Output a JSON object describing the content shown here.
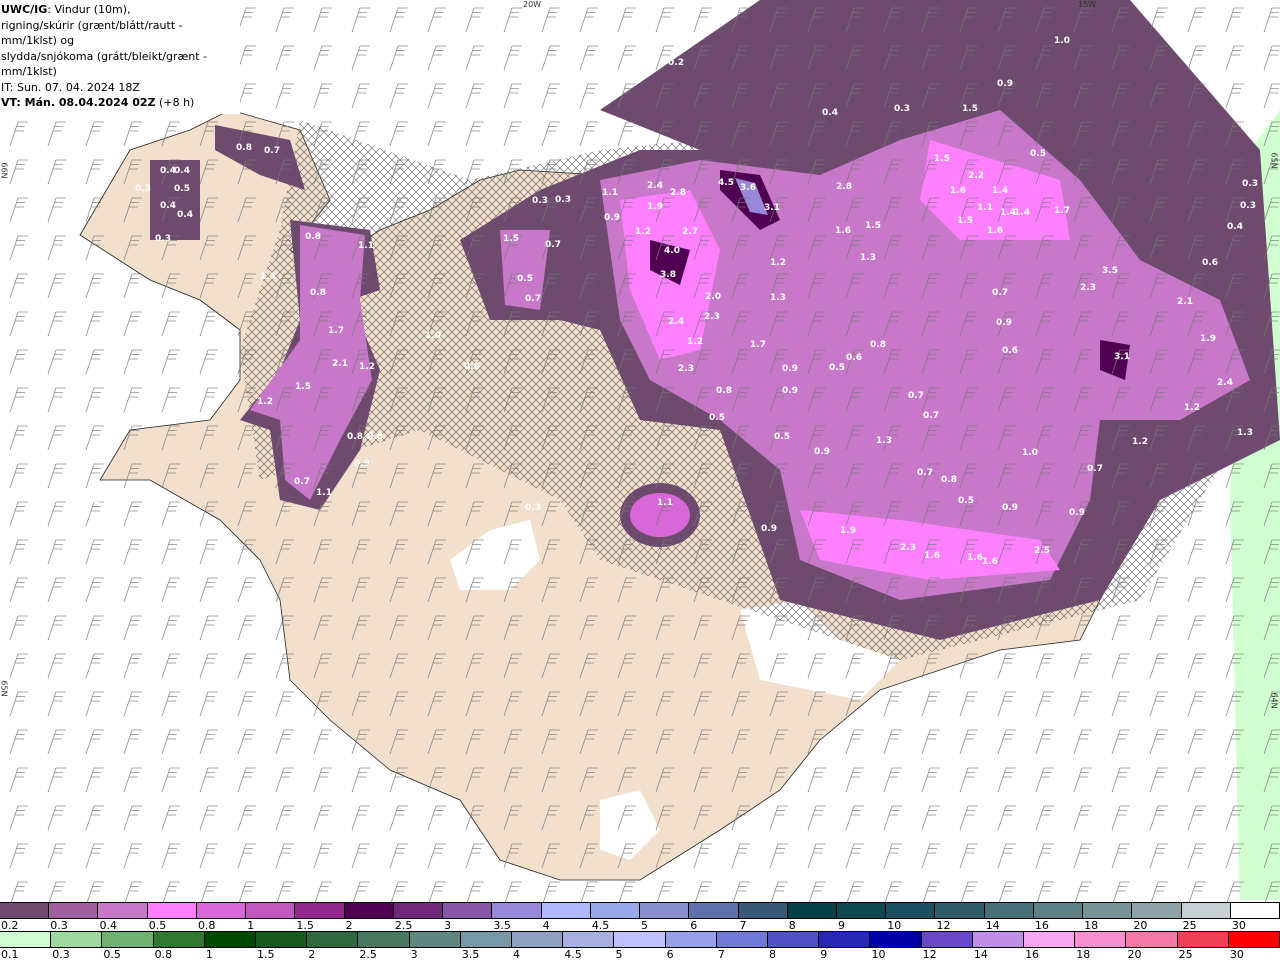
{
  "header": {
    "model": "UWC/IG",
    "line1": ": Vindur (10m),",
    "line2": "rigning/skúrir (grænt/blátt/rautt - mm/1klst) og",
    "line3": "slydda/snjókoma (grátt/bleikt/grænt - mm/1klst)",
    "issue_time": "IT: Sun. 07. 04. 2024 18Z",
    "valid_label": "VT: Mán. 08.04.2024 02Z",
    "valid_offset": " (+8 h)"
  },
  "axes": {
    "lon_labels": [
      "20W",
      "15W"
    ],
    "lat_left": [
      "66N",
      "65N"
    ],
    "lat_right": [
      "65N",
      "64N"
    ]
  },
  "colors": {
    "land": "#f2dfcc",
    "sea": "#ffffff",
    "roads": "#e8643c",
    "coast": "#000000"
  },
  "map_values": [
    "0.3",
    "0.2",
    "1.0",
    "0.9",
    "0.3",
    "0.4",
    "1.5",
    "0.2",
    "0.3",
    "0.8",
    "0.7",
    "0.4",
    "0.4",
    "0.3",
    "0.5",
    "0.4",
    "0.4",
    "0.3",
    "0.5",
    "1.5",
    "2.2",
    "1.6",
    "1.4",
    "1.5",
    "1.1",
    "1.4",
    "1.4",
    "1.7",
    "1.6",
    "0.3",
    "0.3",
    "0.4",
    "0.6",
    "2.4",
    "2.8",
    "4.5",
    "3.6",
    "3.1",
    "2.8",
    "1.1",
    "1.9",
    "0.9",
    "1.2",
    "2.7",
    "4.0",
    "3.8",
    "1.6",
    "1.5",
    "1.3",
    "1.2",
    "1.3",
    "0.3",
    "0.3",
    "1.5",
    "0.7",
    "0.5",
    "0.7",
    "0.8",
    "1.1",
    "1.3",
    "0.8",
    "2.0",
    "2.4",
    "2.3",
    "1.2",
    "2.3",
    "0.8",
    "0.5",
    "1.7",
    "0.9",
    "0.9",
    "0.5",
    "0.6",
    "0.8",
    "1.0",
    "0.6",
    "1.7",
    "2.1",
    "1.2",
    "1.5",
    "1.2",
    "0.8",
    "0.8",
    "0.9",
    "0.7",
    "1.1",
    "0.2",
    "0.3",
    "1.1",
    "3.5",
    "2.3",
    "2.1",
    "0.7",
    "0.9",
    "0.6",
    "3.1",
    "1.9",
    "2.4",
    "1.2",
    "1.3",
    "1.2",
    "0.7",
    "0.5",
    "0.9",
    "1.3",
    "0.7",
    "0.7",
    "0.7",
    "0.8",
    "0.5",
    "0.9",
    "1.0",
    "0.9",
    "0.9",
    "1.9",
    "2.3",
    "1.6",
    "1.6",
    "1.6",
    "2.5"
  ],
  "legend_snow": {
    "labels": [
      "0.2",
      "0.3",
      "0.4",
      "0.5",
      "0.8",
      "1",
      "1.5",
      "2",
      "2.5",
      "3",
      "3.5",
      "4",
      "4.5",
      "5",
      "6",
      "7",
      "8",
      "9",
      "10",
      "12",
      "14",
      "16",
      "18",
      "20",
      "25",
      "30"
    ],
    "colors": [
      "#6e4a6e",
      "#a060a0",
      "#c878c8",
      "#ff80ff",
      "#d868d8",
      "#c058c0",
      "#902890",
      "#500050",
      "#702878",
      "#8858a8",
      "#9888d8",
      "#b0b8ff",
      "#98a8e8",
      "#8890d0",
      "#6070a8",
      "#385878",
      "#084048",
      "#104850",
      "#1c5060",
      "#305c68",
      "#487078",
      "#608088",
      "#789498",
      "#90a4a8",
      "#c8d0d4",
      "#ffffff"
    ]
  },
  "legend_rain": {
    "labels": [
      "0.1",
      "0.3",
      "0.5",
      "0.8",
      "1",
      "1.5",
      "2",
      "2.5",
      "3",
      "3.5",
      "4",
      "4.5",
      "5",
      "6",
      "7",
      "8",
      "9",
      "10",
      "12",
      "14",
      "16",
      "18",
      "20",
      "25",
      "30"
    ],
    "colors": [
      "#d0ffd0",
      "#a0d8a0",
      "#70b070",
      "#307830",
      "#004800",
      "#185820",
      "#306840",
      "#487860",
      "#608880",
      "#7898a8",
      "#90a0c0",
      "#a8b0e0",
      "#c0c0ff",
      "#98a0e8",
      "#7078d8",
      "#5050c8",
      "#2828b8",
      "#0000a8",
      "#6848c8",
      "#c090e8",
      "#f8a8f0",
      "#f890d0",
      "#f878a8",
      "#f04058",
      "#ff0000"
    ]
  }
}
